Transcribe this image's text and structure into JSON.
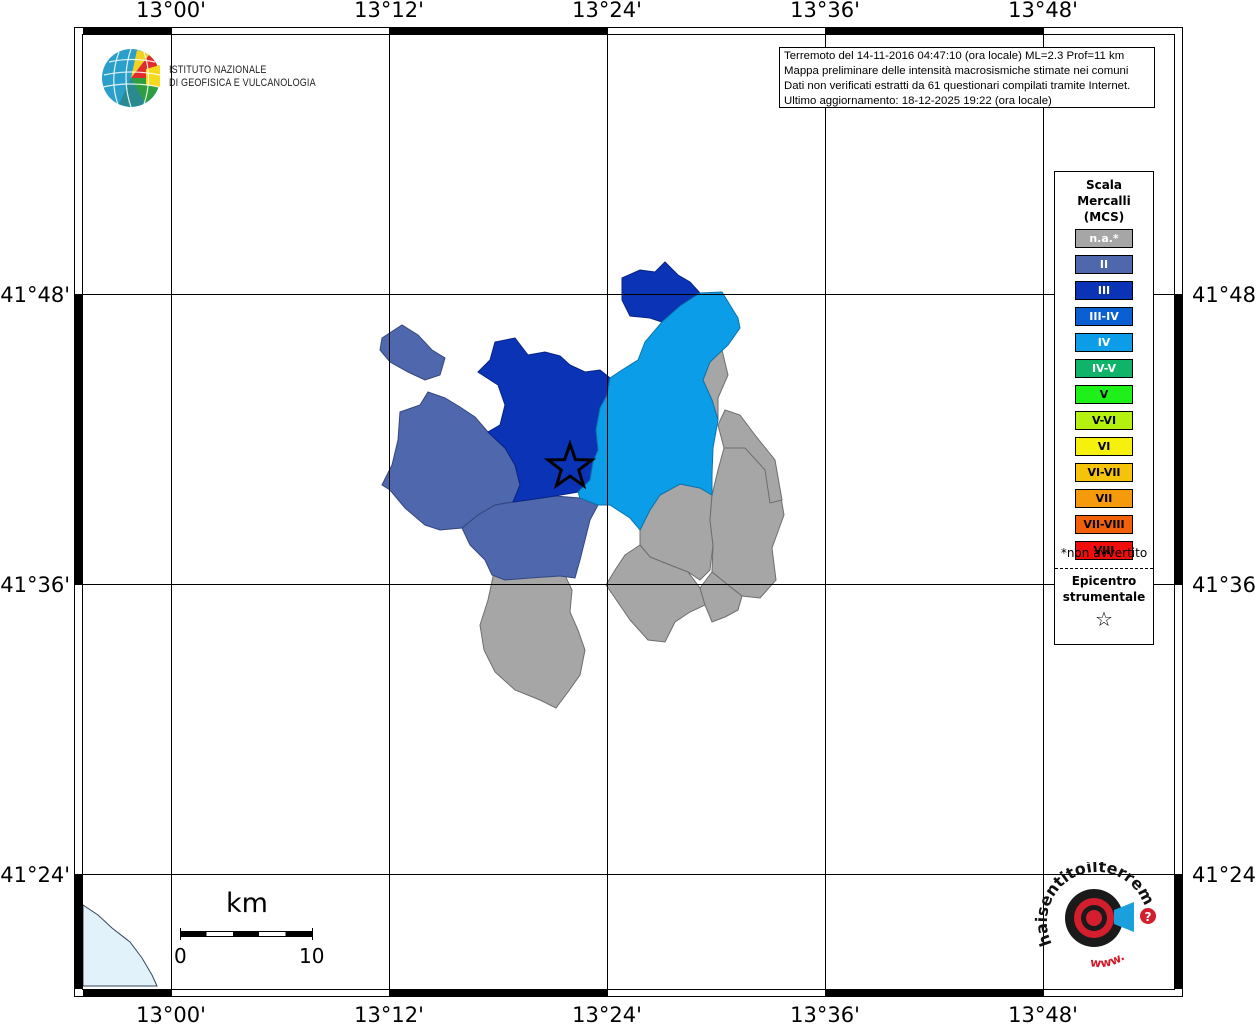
{
  "map": {
    "lon_labels": [
      "13°00'",
      "13°12'",
      "13°24'",
      "13°36'",
      "13°48'"
    ],
    "lat_labels": [
      "41°48'",
      "41°36'",
      "41°24'"
    ]
  },
  "org": {
    "line1": "ISTITUTO NAZIONALE",
    "line2": "DI GEOFISICA E VULCANOLOGIA"
  },
  "info": {
    "line1": "Terremoto del 14-11-2016 04:47:10 (ora locale) ML=2.3 Prof=11 km",
    "line2": "Mappa preliminare delle intensità macrosismiche stimate nei comuni",
    "line3": "Dati non verificati estratti da 61 questionari compilati tramite Internet.",
    "line4": "Ultimo aggiornamento: 18-12-2025 19:22 (ora locale)"
  },
  "legend": {
    "title1": "Scala",
    "title2": "Mercalli",
    "title3": "(MCS)",
    "items": [
      {
        "label": "n.a.*",
        "color": "#a6a6a6"
      },
      {
        "label": "II",
        "color": "#4f67ad"
      },
      {
        "label": "III",
        "color": "#0a33b5"
      },
      {
        "label": "III-IV",
        "color": "#0a60d2"
      },
      {
        "label": "IV",
        "color": "#0b9de8"
      },
      {
        "label": "IV-V",
        "color": "#10b36a"
      },
      {
        "label": "V",
        "color": "#1ef01a"
      },
      {
        "label": "V-VI",
        "color": "#b4f010"
      },
      {
        "label": "VI",
        "color": "#f5f00c"
      },
      {
        "label": "VI-VII",
        "color": "#f5c30a"
      },
      {
        "label": "VII",
        "color": "#f59a0a"
      },
      {
        "label": "VII-VIII",
        "color": "#f2610a"
      },
      {
        "label": "VIII",
        "color": "#f20d0d"
      }
    ],
    "note": "*non avvertito",
    "epicenter1": "Epicentro",
    "epicenter2": "strumentale",
    "epicenter_symbol": "☆"
  },
  "scalebar": {
    "unit": "km",
    "start": "0",
    "end": "10"
  },
  "haisentito": {
    "text": "haisentitoilterremoto.it",
    "www": "www."
  }
}
